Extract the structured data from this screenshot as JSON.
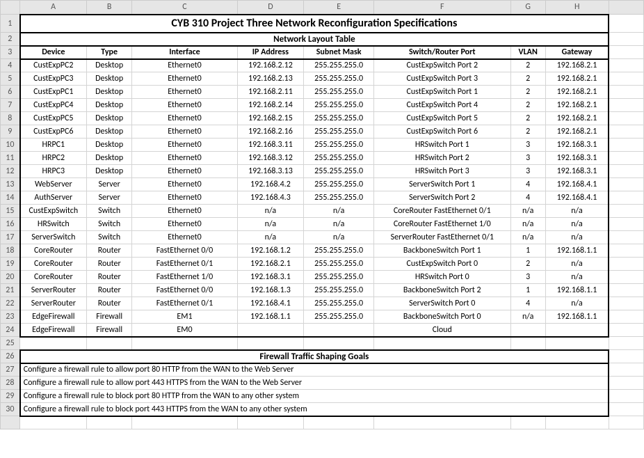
{
  "colHeaders": [
    "A",
    "B",
    "C",
    "D",
    "E",
    "F",
    "G",
    "H",
    ""
  ],
  "rowHeaders": [
    "1",
    "2",
    "3",
    "4",
    "5",
    "6",
    "7",
    "8",
    "9",
    "10",
    "11",
    "12",
    "13",
    "14",
    "15",
    "16",
    "17",
    "18",
    "19",
    "20",
    "21",
    "22",
    "23",
    "24",
    "25",
    "26",
    "27",
    "28",
    "29",
    "30",
    ""
  ],
  "title": "CYB 310 Project Three Network Reconfiguration Specifications",
  "subtitle": "Network Layout Table",
  "headers": {
    "device": "Device",
    "type": "Type",
    "interface": "Interface",
    "ip": "IP Address",
    "mask": "Subnet Mask",
    "port": "Switch/Router Port",
    "vlan": "VLAN",
    "gateway": "Gateway"
  },
  "chart_data": {
    "type": "table",
    "columns": [
      "Device",
      "Type",
      "Interface",
      "IP Address",
      "Subnet Mask",
      "Switch/Router Port",
      "VLAN",
      "Gateway"
    ],
    "rows": [
      [
        "CustExpPC2",
        "Desktop",
        "Ethernet0",
        "192.168.2.12",
        "255.255.255.0",
        "CustExpSwitch Port 2",
        "2",
        "192.168.2.1"
      ],
      [
        "CustExpPC3",
        "Desktop",
        "Ethernet0",
        "192.168.2.13",
        "255.255.255.0",
        "CustExpSwitch Port 3",
        "2",
        "192.168.2.1"
      ],
      [
        "CustExpPC1",
        "Desktop",
        "Ethernet0",
        "192.168.2.11",
        "255.255.255.0",
        "CustExpSwitch Port 1",
        "2",
        "192.168.2.1"
      ],
      [
        "CustExpPC4",
        "Desktop",
        "Ethernet0",
        "192.168.2.14",
        "255.255.255.0",
        "CustExpSwitch Port 4",
        "2",
        "192.168.2.1"
      ],
      [
        "CustExpPC5",
        "Desktop",
        "Ethernet0",
        "192.168.2.15",
        "255.255.255.0",
        "CustExpSwitch Port 5",
        "2",
        "192.168.2.1"
      ],
      [
        "CustExpPC6",
        "Desktop",
        "Ethernet0",
        "192.168.2.16",
        "255.255.255.0",
        "CustExpSwitch Port 6",
        "2",
        "192.168.2.1"
      ],
      [
        "HRPC1",
        "Desktop",
        "Ethernet0",
        "192.168.3.11",
        "255.255.255.0",
        "HRSwitch Port 1",
        "3",
        "192.168.3.1"
      ],
      [
        "HRPC2",
        "Desktop",
        "Ethernet0",
        "192.168.3.12",
        "255.255.255.0",
        "HRSwitch Port 2",
        "3",
        "192.168.3.1"
      ],
      [
        "HRPC3",
        "Desktop",
        "Ethernet0",
        "192.168.3.13",
        "255.255.255.0",
        "HRSwitch Port 3",
        "3",
        "192.168.3.1"
      ],
      [
        "WebServer",
        "Server",
        "Ethernet0",
        "192.168.4.2",
        "255.255.255.0",
        "ServerSwitch Port 1",
        "4",
        "192.168.4.1"
      ],
      [
        "AuthServer",
        "Server",
        "Ethernet0",
        "192.168.4.3",
        "255.255.255.0",
        "ServerSwitch Port 2",
        "4",
        "192.168.4.1"
      ],
      [
        "CustExpSwitch",
        "Switch",
        "Ethernet0",
        "n/a",
        "n/a",
        "CoreRouter FastEthernet 0/1",
        "n/a",
        "n/a"
      ],
      [
        "HRSwitch",
        "Switch",
        "Ethernet0",
        "n/a",
        "n/a",
        "CoreRouter FastEthernet 1/0",
        "n/a",
        "n/a"
      ],
      [
        "ServerSwitch",
        "Switch",
        "Ethernet0",
        "n/a",
        "n/a",
        "ServerRouter FastEthernet 0/1",
        "n/a",
        "n/a"
      ],
      [
        "CoreRouter",
        "Router",
        "FastEthernet 0/0",
        "192.168.1.2",
        "255.255.255.0",
        "BackboneSwitch Port 1",
        "1",
        "192.168.1.1"
      ],
      [
        "CoreRouter",
        "Router",
        "FastEthernet 0/1",
        "192.168.2.1",
        "255.255.255.0",
        "CustExpSwitch Port 0",
        "2",
        "n/a"
      ],
      [
        "CoreRouter",
        "Router",
        "FastEthernet 1/0",
        "192.168.3.1",
        "255.255.255.0",
        "HRSwitch Port 0",
        "3",
        "n/a"
      ],
      [
        "ServerRouter",
        "Router",
        "FastEthernet 0/0",
        "192.168.1.3",
        "255.255.255.0",
        "BackboneSwitch Port 2",
        "1",
        "192.168.1.1"
      ],
      [
        "ServerRouter",
        "Router",
        "FastEthernet 0/1",
        "192.168.4.1",
        "255.255.255.0",
        "ServerSwitch Port 0",
        "4",
        "n/a"
      ],
      [
        "EdgeFirewall",
        "Firewall",
        "EM1",
        "192.168.1.1",
        "255.255.255.0",
        "BackboneSwitch Port 0",
        "n/a",
        "192.168.1.1"
      ],
      [
        "EdgeFirewall",
        "Firewall",
        "EM0",
        "",
        "",
        "Cloud",
        "",
        ""
      ]
    ]
  },
  "firewall": {
    "title": "Firewall Traffic Shaping Goals",
    "rules": [
      "Configure a firewall rule to allow port 80 HTTP from the WAN to the Web Server",
      "Configure a firewall rule to allow port 443 HTTPS from the WAN to the Web Server",
      "Configure a firewall rule to block port 80 HTTP from the WAN to any other system",
      "Configure a firewall rule to block port 443 HTTPS from the WAN to any other system"
    ]
  }
}
